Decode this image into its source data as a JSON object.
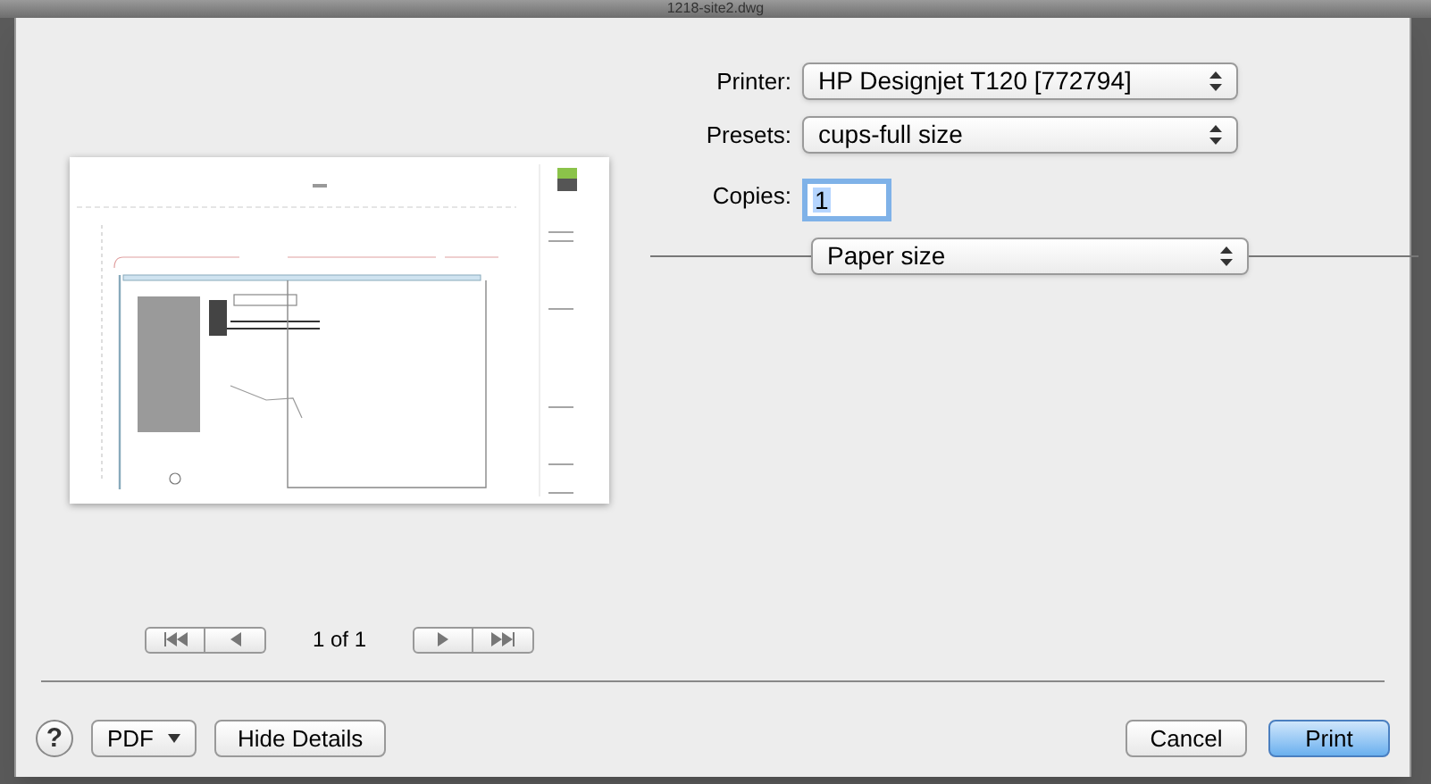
{
  "window": {
    "title": "1218-site2.dwg"
  },
  "fields": [
    {
      "kind": "select",
      "label": "Printer:",
      "value": "HP Designjet T120 [772794]"
    },
    {
      "kind": "select",
      "label": "Presets:",
      "value": "cups-full size"
    },
    {
      "kind": "input",
      "label": "Copies:",
      "value": "1",
      "text_selected": true
    }
  ],
  "section_popup": {
    "value": "Paper size"
  },
  "pager": {
    "page_text": "1 of 1"
  },
  "footer_left": [
    {
      "kind": "help",
      "label": "?"
    },
    {
      "kind": "menu",
      "label": "PDF"
    },
    {
      "kind": "button",
      "label": "Hide Details"
    }
  ],
  "footer_right": [
    {
      "label": "Cancel",
      "default": false
    },
    {
      "label": "Print",
      "default": true
    }
  ]
}
